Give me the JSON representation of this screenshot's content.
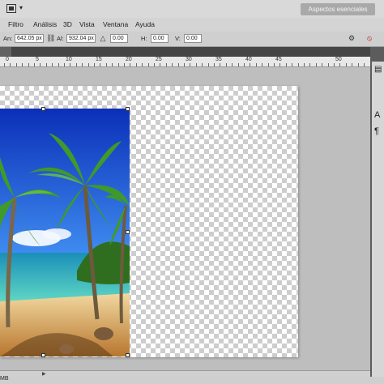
{
  "workspace": {
    "label": "Aspectos esenciales"
  },
  "menu": {
    "items": [
      "Filtro",
      "Análisis",
      "3D",
      "Vista",
      "Ventana",
      "Ayuda"
    ]
  },
  "options": {
    "width_label": "An:",
    "width_value": "642.05 px",
    "height_label": "Al:",
    "height_value": "932.04 px",
    "rotation_value": "0.00",
    "h_label": "H:",
    "h_value": "0.00",
    "v_label": "V:",
    "v_value": "0.00"
  },
  "ruler": {
    "labels": [
      "0",
      "5",
      "10",
      "15",
      "20",
      "25",
      "30",
      "35",
      "40",
      "45",
      "50"
    ]
  },
  "status": {
    "text": "MB"
  },
  "right_panel": {
    "icons": [
      "layers-icon",
      "type-icon",
      "paragraph-icon"
    ],
    "glyphs": [
      "A",
      "¶"
    ]
  },
  "colors": {
    "sky": "#1e4fd6",
    "sea": "#2bb3b0",
    "sand": "#d9a35a"
  }
}
